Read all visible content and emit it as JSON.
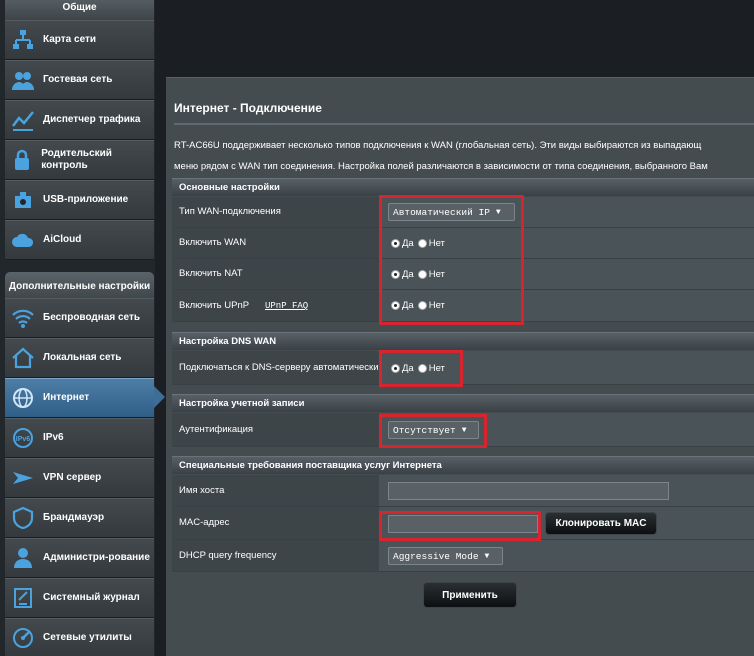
{
  "sidebar": {
    "general_heading": "Общие",
    "general_items": [
      {
        "label": "Карта сети",
        "icon": "network-map-icon"
      },
      {
        "label": "Гостевая сеть",
        "icon": "guest-network-icon"
      },
      {
        "label": "Диспетчер трафика",
        "icon": "traffic-manager-icon"
      },
      {
        "label": "Родительский контроль",
        "icon": "parental-control-icon"
      },
      {
        "label": "USB-приложение",
        "icon": "usb-app-icon"
      },
      {
        "label": "AiCloud",
        "icon": "aicloud-icon"
      }
    ],
    "advanced_heading": "Дополнительные настройки",
    "advanced_items": [
      {
        "label": "Беспроводная сеть",
        "icon": "wireless-icon"
      },
      {
        "label": "Локальная сеть",
        "icon": "lan-home-icon"
      },
      {
        "label": "Интернет",
        "icon": "internet-globe-icon",
        "active": true
      },
      {
        "label": "IPv6",
        "icon": "ipv6-icon"
      },
      {
        "label": "VPN сервер",
        "icon": "vpn-icon"
      },
      {
        "label": "Брандмауэр",
        "icon": "firewall-icon"
      },
      {
        "label": "Администри-рование",
        "icon": "admin-icon"
      },
      {
        "label": "Системный журнал",
        "icon": "system-log-icon"
      },
      {
        "label": "Сетевые утилиты",
        "icon": "network-tools-icon"
      }
    ]
  },
  "main": {
    "title": "Интернет - Подключение",
    "description_line1": "RT-AC66U поддерживает несколько типов подключения к WAN (глобальная сеть). Эти виды выбираются из выпадающ",
    "description_line2": "меню рядом с WAN тип соединения. Настройка полей различаются в зависимости от типа соединения, выбранного Вам",
    "basic": {
      "heading": "Основные настройки",
      "wan_type_label": "Тип WAN-подключения",
      "wan_type_value": "Автоматический IP",
      "enable_wan_label": "Включить WAN",
      "enable_nat_label": "Включить NAT",
      "enable_upnp_label": "Включить UPnP",
      "upnp_faq_link": "UPnP  FAQ"
    },
    "radio_yes": "Да",
    "radio_no": "Нет",
    "dns": {
      "heading": "Настройка DNS WAN",
      "auto_dns_label": "Подключаться к DNS-серверу автоматически"
    },
    "account": {
      "heading": "Настройка учетной записи",
      "auth_label": "Аутентификация",
      "auth_value": "Отсутствует"
    },
    "isp": {
      "heading": "Специальные требования поставщика услуг Интернета",
      "hostname_label": "Имя хоста",
      "hostname_value": "",
      "mac_label": "MAC-адрес",
      "mac_value": "",
      "clone_mac_button": "Клонировать MAC",
      "dhcp_label": "DHCP query frequency",
      "dhcp_value": "Aggressive Mode"
    },
    "apply_button": "Применить"
  },
  "colors": {
    "highlight_box": "#d8242f",
    "active_nav": "#3d6e97",
    "panel": "#454c50"
  }
}
